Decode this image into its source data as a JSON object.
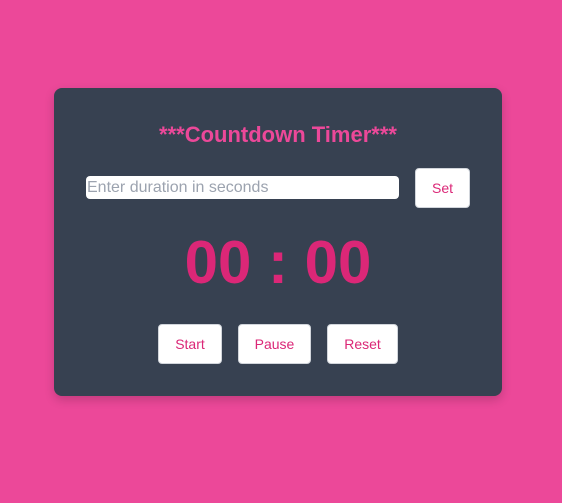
{
  "app": {
    "title": "***Countdown Timer***"
  },
  "duration": {
    "placeholder": "Enter duration in seconds",
    "value": "",
    "set_label": "Set"
  },
  "timer": {
    "minutes": "00",
    "separator": " : ",
    "seconds": "00"
  },
  "controls": {
    "start_label": "Start",
    "pause_label": "Pause",
    "reset_label": "Reset"
  },
  "colors": {
    "page_background": "#ec4899",
    "card_background": "#374151",
    "accent": "#db2777",
    "title": "#ec4899",
    "button_background": "#ffffff"
  }
}
